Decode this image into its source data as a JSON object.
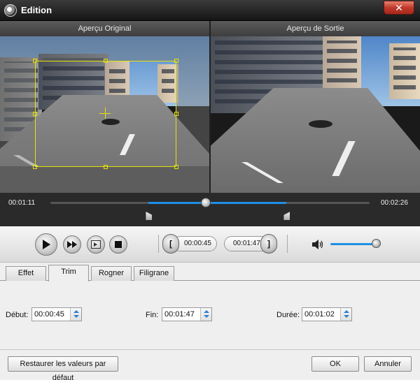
{
  "window": {
    "title": "Edition",
    "close_glyph": "✕"
  },
  "preview": {
    "original_label": "Aperçu Original",
    "output_label": "Aperçu de Sortie"
  },
  "timeline": {
    "current_time": "00:01:11",
    "total_time": "00:02:26",
    "playhead_fraction": 0.486,
    "selection_start_fraction": 0.308,
    "selection_end_fraction": 0.74
  },
  "controls": {
    "play_icon": "play-icon",
    "fast_forward_icon": "fast-forward-icon",
    "frame_icon": "next-frame-icon",
    "stop_icon": "stop-icon",
    "trim_start": "00:00:45",
    "trim_end": "00:01:47",
    "volume_fraction": 0.9
  },
  "tabs": [
    {
      "label": "Effet"
    },
    {
      "label": "Trim"
    },
    {
      "label": "Rogner"
    },
    {
      "label": "Filigrane"
    }
  ],
  "active_tab": "Trim",
  "trim_fields": {
    "start_label": "Début:",
    "start_value": "00:00:45",
    "end_label": "Fin:",
    "end_value": "00:01:47",
    "duration_label": "Durée:",
    "duration_value": "00:01:02"
  },
  "buttons": {
    "restore_defaults": "Restaurer les valeurs par défaut",
    "ok": "OK",
    "cancel": "Annuler"
  },
  "colors": {
    "accent": "#1f8fe6",
    "crop_frame": "#e7e20a"
  }
}
